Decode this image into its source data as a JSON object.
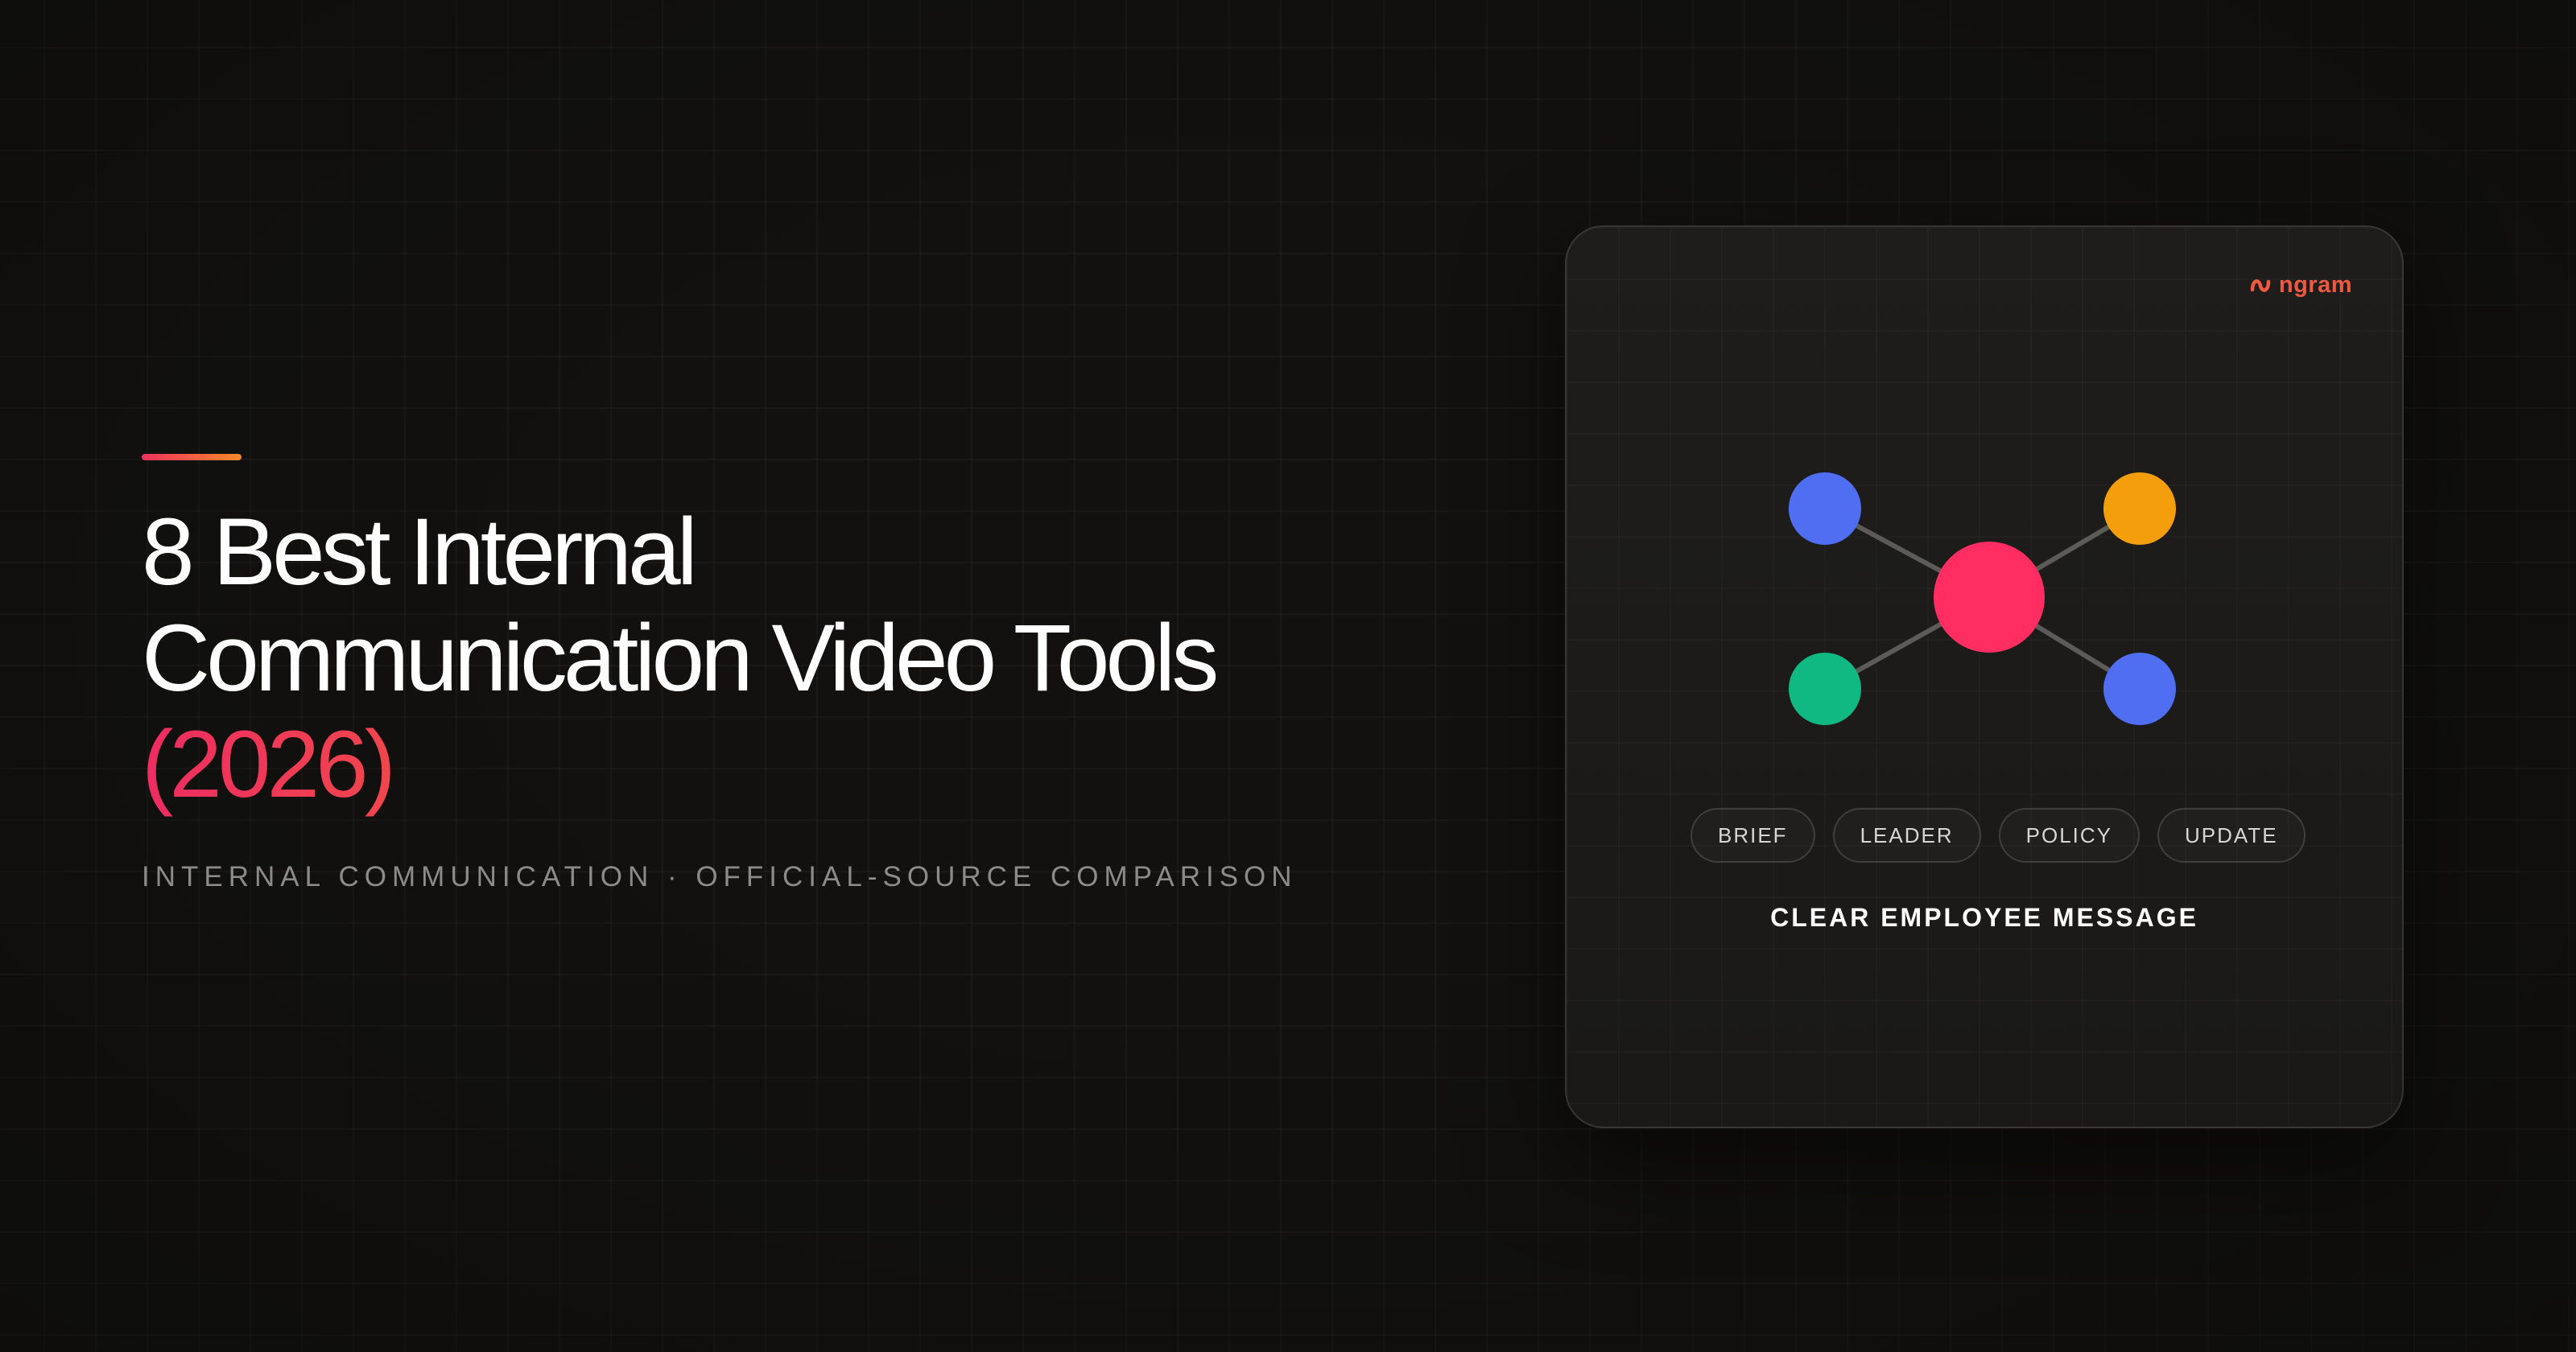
{
  "hero": {
    "title_line1": "8 Best Internal",
    "title_line2": "Communication Video Tools",
    "title_year": "(2026)",
    "subtitle": "INTERNAL COMMUNICATION · OFFICIAL-SOURCE COMPARISON"
  },
  "card": {
    "logo_text": "ngram",
    "tags": [
      "BRIEF",
      "LEADER",
      "POLICY",
      "UPDATE"
    ],
    "caption": "CLEAR EMPLOYEE MESSAGE"
  },
  "colors": {
    "background": "#12110f",
    "accent_start": "#ee2c62",
    "accent_end": "#f59a20",
    "node_center": "#ff2d62",
    "node_blue": "#4f6ef2",
    "node_orange": "#f59e0b",
    "node_green": "#10b981",
    "logo": "#ee5a3f"
  },
  "icons": {
    "logo_mark": "ngram-logo-icon"
  }
}
